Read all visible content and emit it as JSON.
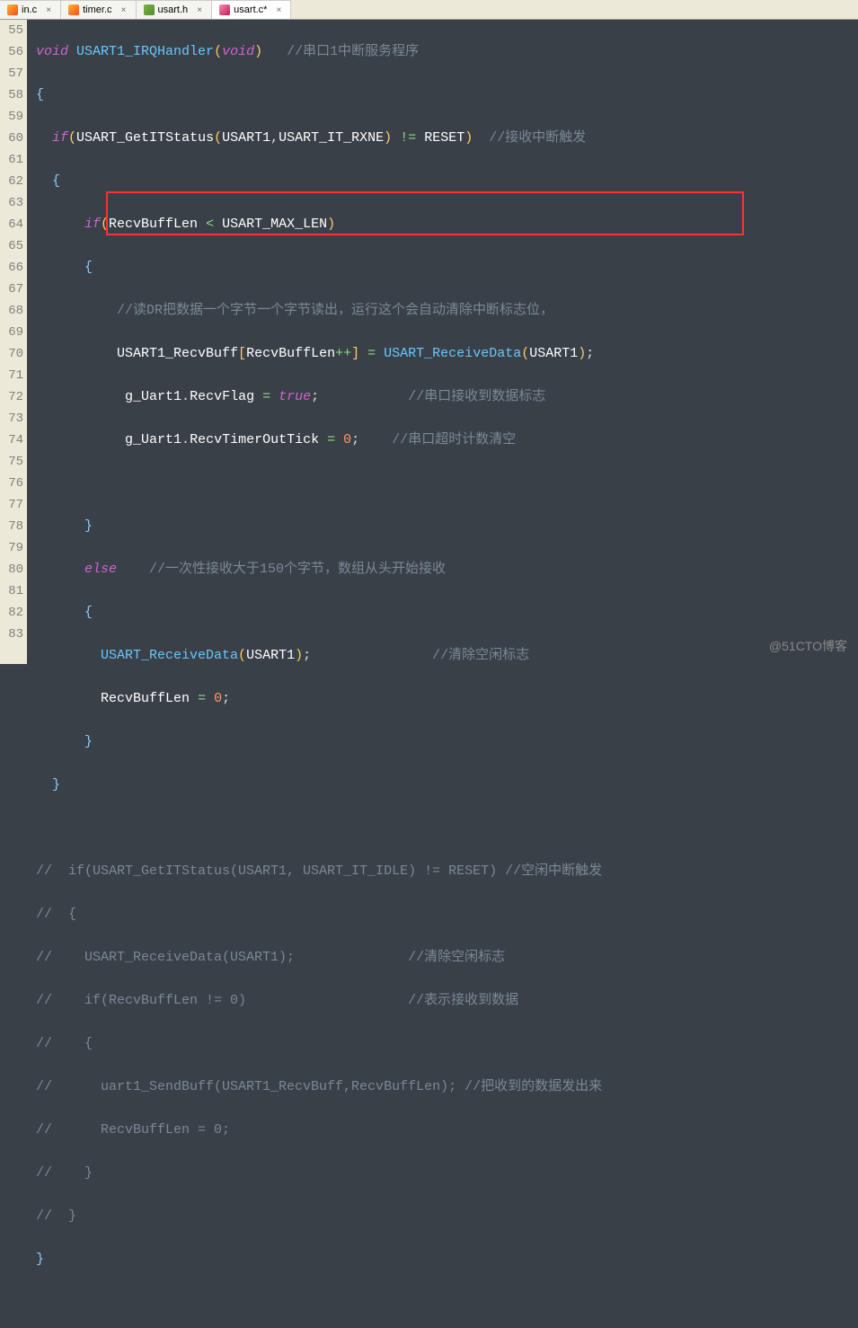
{
  "tabs": [
    {
      "label": "in.c",
      "icon": "icon-c",
      "active": false,
      "closeable": true
    },
    {
      "label": "timer.c",
      "icon": "icon-c",
      "active": false,
      "closeable": true
    },
    {
      "label": "usart.h",
      "icon": "icon-h",
      "active": false,
      "closeable": true
    },
    {
      "label": "usart.c*",
      "icon": "icon-c2",
      "active": true,
      "closeable": true
    }
  ],
  "line_start": 55,
  "line_end": 83,
  "code": {
    "l55": {
      "void": "void",
      "fn": "USART1_IRQHandler",
      "arg": "void",
      "cmt": "//串口1中断服务程序"
    },
    "l57": {
      "if": "if",
      "fn": "USART_GetITStatus",
      "a1": "USART1",
      "a2": "USART_IT_RXNE",
      "op": "!=",
      "rhs": "RESET",
      "cmt": "//接收中断触发"
    },
    "l59": {
      "if": "if",
      "a": "RecvBuffLen",
      "op": "<",
      "b": "USART_MAX_LEN"
    },
    "l61": {
      "cmt": "//读DR把数据一个字节一个字节读出，运行这个会自动清除中断标志位，"
    },
    "l62": {
      "a": "USART1_RecvBuff",
      "idx": "RecvBuffLen",
      "pp": "++",
      "eq": "=",
      "fn": "USART_ReceiveData",
      "arg": "USART1"
    },
    "l63": {
      "obj": "g_Uart1",
      "mem": "RecvFlag",
      "eq": "=",
      "val": "true",
      "cmt": "//串口接收到数据标志"
    },
    "l64": {
      "obj": "g_Uart1",
      "mem": "RecvTimerOutTick",
      "eq": "=",
      "val": "0",
      "cmt": "//串口超时计数清空"
    },
    "l67": {
      "else": "else",
      "cmt": "//一次性接收大于150个字节，数组从头开始接收"
    },
    "l69": {
      "fn": "USART_ReceiveData",
      "arg": "USART1",
      "cmt": "//清除空闲标志"
    },
    "l70": {
      "a": "RecvBuffLen",
      "eq": "=",
      "val": "0"
    },
    "l74": {
      "c1": "//  if(USART_GetITStatus(USART1, USART_IT_IDLE) != RESET) ",
      "c2": "//空闲中断触发"
    },
    "l75": {
      "cmt": "//  {"
    },
    "l76": {
      "c1": "//    USART_ReceiveData(USART1);              ",
      "c2": "//清除空闲标志"
    },
    "l77": {
      "c1": "//    if(RecvBuffLen != 0)                    ",
      "c2": "//表示接收到数据"
    },
    "l78": {
      "cmt": "//    {"
    },
    "l79": {
      "c1": "//      uart1_SendBuff(USART1_RecvBuff,RecvBuffLen); ",
      "c2": "//把收到的数据发出来"
    },
    "l80": {
      "cmt": "//      RecvBuffLen = 0;"
    },
    "l81": {
      "cmt": "//    }"
    },
    "l82": {
      "cmt": "//  }"
    }
  },
  "watermark": "@51CTO博客"
}
